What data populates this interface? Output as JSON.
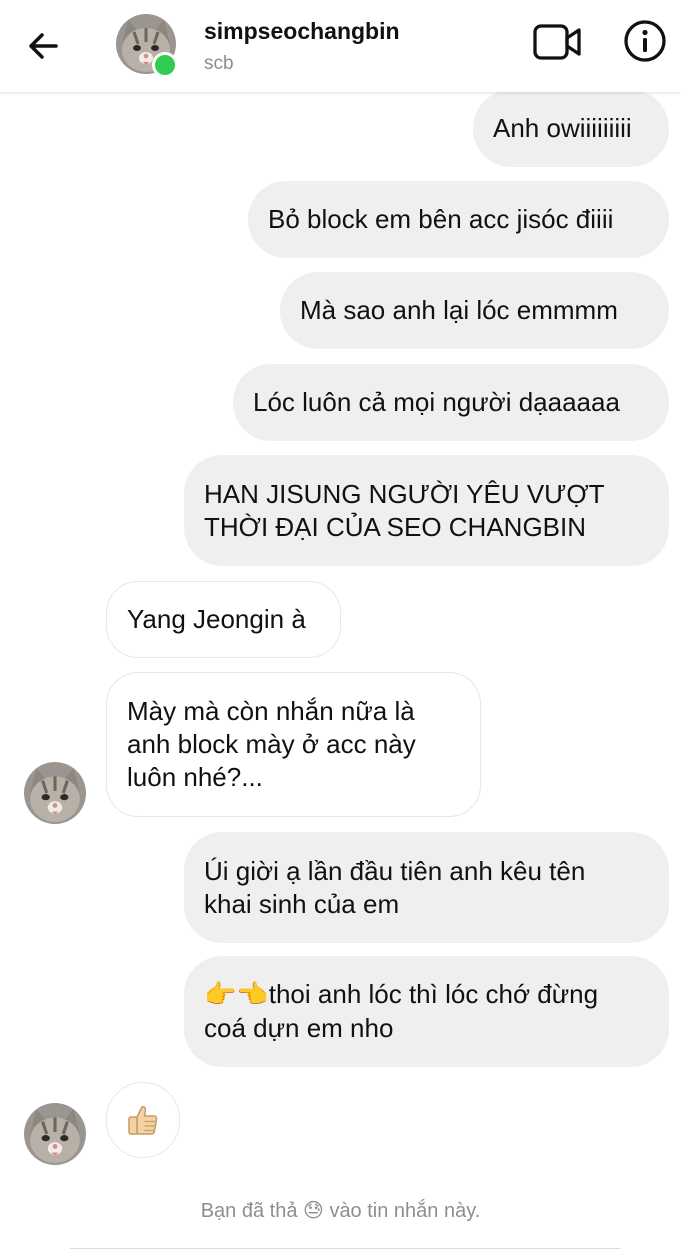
{
  "header": {
    "username": "simpseochangbin",
    "subname": "scb",
    "online": true
  },
  "messages": [
    {
      "direction": "out",
      "text": "Anh owiiiiiiiii"
    },
    {
      "direction": "out",
      "text": "Bỏ block em bên acc jisóc điiii"
    },
    {
      "direction": "out",
      "text": "Mà sao anh lại lóc emmmm"
    },
    {
      "direction": "out",
      "text": "Lóc luôn cả mọi người dạaaaaa"
    },
    {
      "direction": "out",
      "lines": [
        "HAN JISUNG NGƯỜI YÊU VƯỢT",
        "THỜI ĐẠI CỦA SEO CHANGBIN"
      ]
    },
    {
      "direction": "in",
      "text": "Yang Jeongin à"
    },
    {
      "direction": "in",
      "lines": [
        "Mày mà còn nhắn nữa là",
        "anh block mày ở acc này",
        "luôn nhé?..."
      ]
    },
    {
      "direction": "out",
      "lines": [
        "Úi giời ạ lần đầu tiên anh kêu tên",
        "khai sinh của em"
      ]
    },
    {
      "direction": "out",
      "emoji_prefix": "👉👈",
      "lines": [
        "thoi anh lóc thì lóc chớ đừng",
        "coá dựn em nho"
      ]
    },
    {
      "direction": "in",
      "emoji": "👍"
    }
  ],
  "reaction_note": {
    "before": "Bạn đã thả",
    "emoji": "😓",
    "after": "vào tin nhắn này."
  },
  "colors": {
    "outgoing_bubble": "#efefef",
    "incoming_bubble_border": "#e6e6e6",
    "online_dot": "#2fcc4f",
    "muted_text": "#8e8e8e"
  },
  "icons": [
    "back-arrow-icon",
    "video-call-icon",
    "info-icon",
    "thumbs-up-icon",
    "cat-avatar"
  ]
}
